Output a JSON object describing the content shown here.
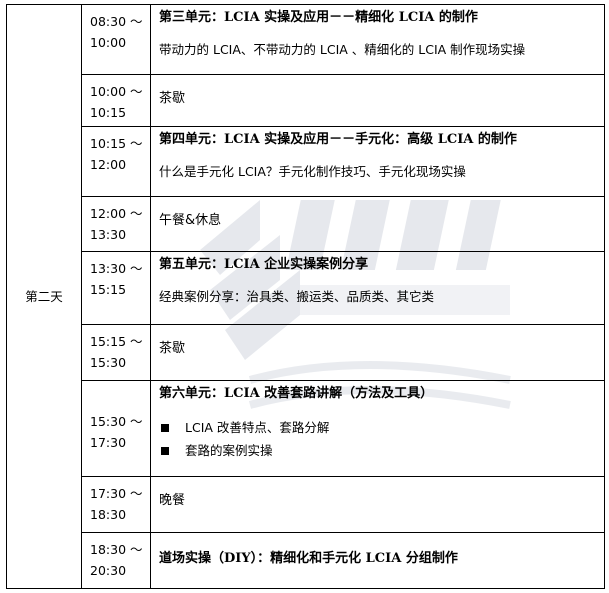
{
  "day": "第二天",
  "colors": {
    "border": "#000000",
    "watermark": "#c9ced8"
  },
  "rows": [
    {
      "time_start": "08:30 ～",
      "time_end": "10:00",
      "title": "第三单元：LCIA 实操及应用－－精细化 LCIA 的制作",
      "desc": "带动力的 LCIA、不带动力的 LCIA 、精细化的 LCIA 制作现场实操"
    },
    {
      "time_start": "10:00 ～",
      "time_end": "10:15",
      "text": "茶歇"
    },
    {
      "time_start": "10:15 ～",
      "time_end": "12:00",
      "title": "第四单元：LCIA 实操及应用－－手元化：高级 LCIA 的制作",
      "desc": "什么是手元化 LCIA？手元化制作技巧、手元化现场实操"
    },
    {
      "time_start": "12:00 ～",
      "time_end": "13:30",
      "text": "午餐&休息"
    },
    {
      "time_start": "13:30 ～",
      "time_end": "15:15",
      "title": "第五单元：LCIA 企业实操案例分享",
      "desc": "经典案例分享：治具类、搬运类、品质类、其它类"
    },
    {
      "time_start": "15:15 ～",
      "time_end": "15:30",
      "text": "茶歇"
    },
    {
      "time_start": "15:30 ～",
      "time_end": "17:30",
      "title": "第六单元：LCIA 改善套路讲解（方法及工具）",
      "bullets": [
        "LCIA 改善特点、套路分解",
        "套路的案例实操"
      ]
    },
    {
      "time_start": "17:30 ～",
      "time_end": "18:30",
      "text": "晚餐"
    },
    {
      "time_start": "18:30 ～",
      "time_end": "20:30",
      "bold_text": "道场实操（DIY）：精细化和手元化 LCIA 分组制作"
    }
  ]
}
